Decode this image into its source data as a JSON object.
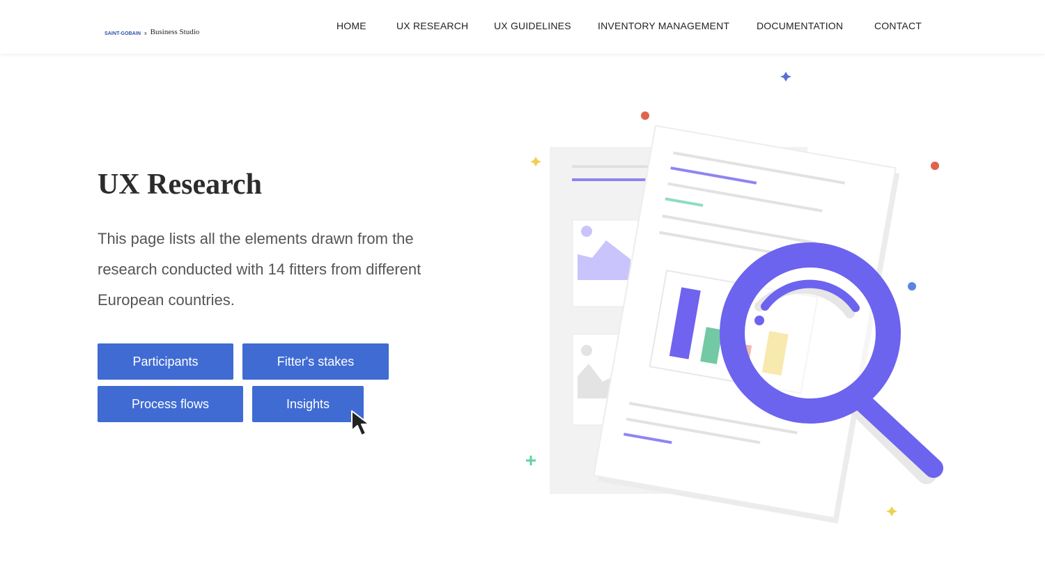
{
  "header": {
    "logo": {
      "brand_left": "SAINT-GOBAIN",
      "separator": "x",
      "brand_right": "Business Studio"
    },
    "nav": [
      "HOME",
      "UX RESEARCH",
      "UX GUIDELINES",
      "INVENTORY MANAGEMENT",
      "DOCUMENTATION",
      "CONTACT"
    ]
  },
  "hero": {
    "title": "UX Research",
    "description": "This page lists all the elements drawn from the research conducted with 14 fitters from different European countries.",
    "buttons": {
      "participants": "Participants",
      "stakes": "Fitter's stakes",
      "flows": "Process flows",
      "insights": "Insights"
    }
  },
  "colors": {
    "button": "#3f6bd3",
    "accent": "#6c63ff"
  },
  "illustration": {
    "icon": "document-magnifier-illustration"
  }
}
